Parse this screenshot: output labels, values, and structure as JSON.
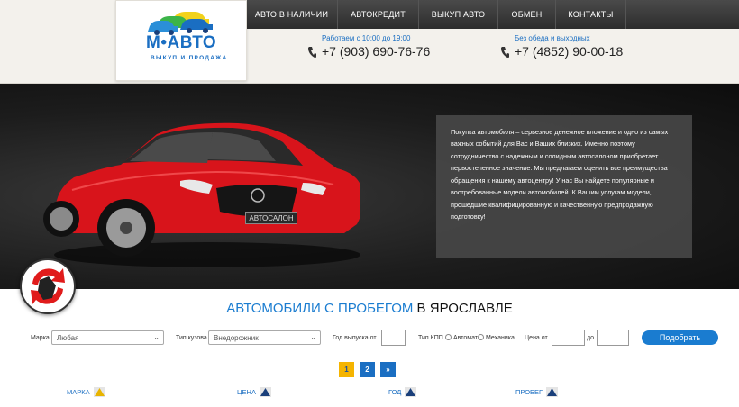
{
  "logo": {
    "word": "М•АВТО",
    "subtitle": "выкуп и продажа"
  },
  "nav": [
    "АВТО В НАЛИЧИИ",
    "АВТОКРЕДИТ",
    "ВЫКУП АВТО",
    "ОБМЕН",
    "КОНТАКТЫ"
  ],
  "contacts": [
    {
      "hours": "Работаем с 10:00 до 19:00",
      "phone": "+7 (903) 690-76-76"
    },
    {
      "hours": "Без обеда и выходных",
      "phone": "+7 (4852) 90-00-18"
    }
  ],
  "hero": {
    "plate": "АВТОСАЛОН",
    "text": "Покупка автомобиля – серьезное денежное вложение и одно из самых важных событий для Вас и Ваших близких. Именно поэтому сотрудничество с надежным и солидным автосалоном приобретает первостепенное значение. Мы предлагаем оценить все преимущества обращения к нашему автоцентру! У нас Вы найдете популярные и востребованные модели автомобилей. К Вашим услугам модели, прошедшие квалифицированную и качественную предпродажную подготовку!"
  },
  "section": {
    "title_blue": "АВТОМОБИЛИ С ПРОБЕГОМ",
    "title_rest": " В ЯРОСЛАВЛЕ"
  },
  "filters": {
    "brand_label": "Марка",
    "brand_value": "Любая",
    "body_label": "Тип кузова",
    "body_value": "Внедорожник",
    "year_label": "Год выпуска от",
    "gearbox_label": "Тип КПП",
    "auto_label": "Автомат",
    "manual_label": "Механика",
    "price_label": "Цена от",
    "price_to_label": "до",
    "submit": "Подобрать"
  },
  "pagination": [
    "1",
    "2",
    "»"
  ],
  "sort_headers": [
    "МАРКА",
    "ЦЕНА",
    "ГОД",
    "ПРОБЕГ"
  ],
  "colors": {
    "accent": "#1a7cd0",
    "pager_active": "#f5b400",
    "car": "#d8141b",
    "nav_bg": "#333333"
  }
}
